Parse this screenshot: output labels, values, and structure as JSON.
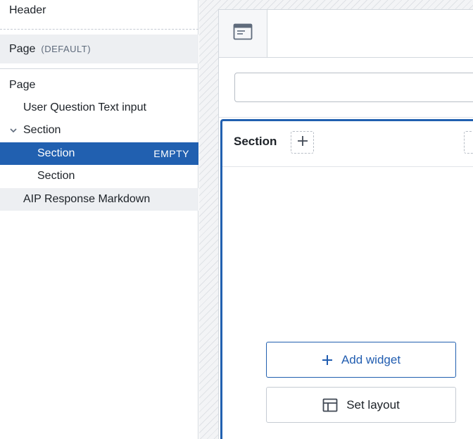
{
  "outline": {
    "header_label": "Header",
    "default_page": {
      "label": "Page",
      "tag": "(DEFAULT)"
    },
    "tree": {
      "page_label": "Page",
      "user_question_label": "User Question Text input",
      "section_label": "Section",
      "selected_section": {
        "label": "Section",
        "status": "EMPTY"
      },
      "child_section_label": "Section",
      "aip_response_label": "AIP Response Markdown"
    }
  },
  "canvas": {
    "tab_icon": "page-layout-icon",
    "input_value": "",
    "section": {
      "title": "Section",
      "add_widget_label": "Add widget",
      "set_layout_label": "Set layout"
    }
  },
  "colors": {
    "accent": "#2160b0",
    "selected_bg": "#2160b0",
    "hover_bg": "#edeff2"
  }
}
